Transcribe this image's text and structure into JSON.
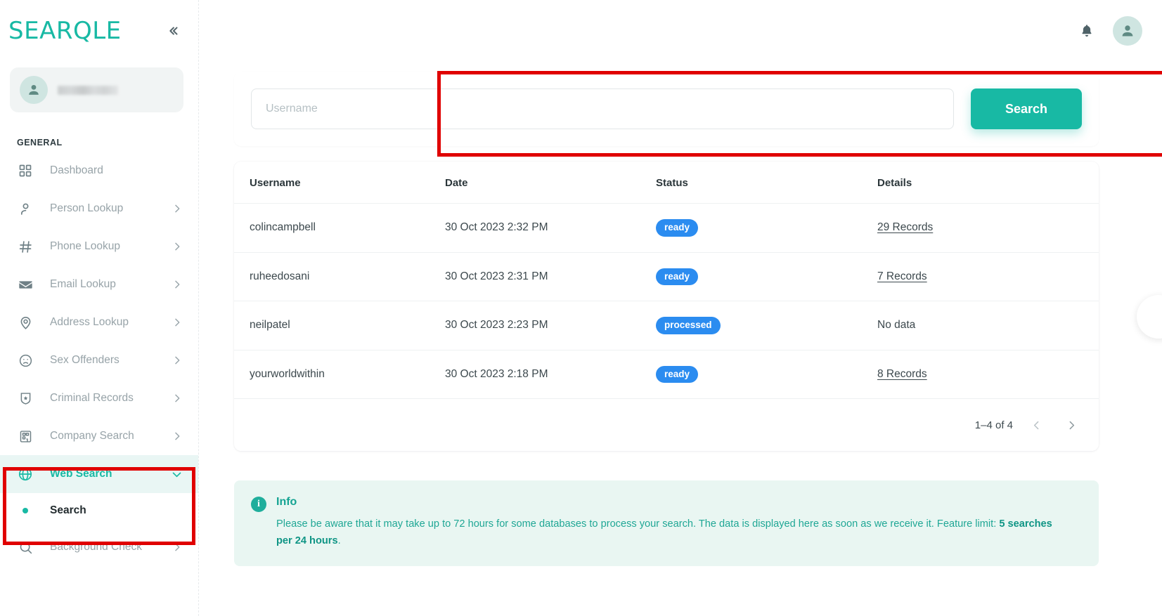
{
  "brand": {
    "name": "SEARQLE",
    "accent": "#18b9a4"
  },
  "sidebar": {
    "collapse_icon": "chevrons-left-icon",
    "profile": {
      "avatar_icon": "user-avatar-icon",
      "name_redacted": ""
    },
    "section_title": "GENERAL",
    "items": [
      {
        "label": "Dashboard",
        "icon": "grid-dashboard-icon",
        "caret": false
      },
      {
        "label": "Person Lookup",
        "icon": "person-icon",
        "caret": true
      },
      {
        "label": "Phone Lookup",
        "icon": "hash-icon",
        "caret": true
      },
      {
        "label": "Email Lookup",
        "icon": "envelope-icon",
        "caret": true
      },
      {
        "label": "Address Lookup",
        "icon": "map-pin-icon",
        "caret": true
      },
      {
        "label": "Sex Offenders",
        "icon": "sad-face-icon",
        "caret": true
      },
      {
        "label": "Criminal Records",
        "icon": "shield-badge-icon",
        "caret": true
      },
      {
        "label": "Company Search",
        "icon": "building-icon",
        "caret": true
      }
    ],
    "active_item": {
      "label": "Web Search",
      "icon": "globe-icon",
      "caret": "chevron-down-icon"
    },
    "active_subitem": {
      "label": "Search",
      "icon": "dot-bullet-icon"
    },
    "after_items": [
      {
        "label": "Background Check",
        "icon": "magnifier-icon",
        "caret": true
      }
    ]
  },
  "topbar": {
    "notifications_icon": "bell-icon",
    "account_icon": "user-avatar-icon"
  },
  "search": {
    "placeholder": "Username",
    "value": "",
    "button_label": "Search"
  },
  "table": {
    "columns": [
      "Username",
      "Date",
      "Status",
      "Details"
    ],
    "rows": [
      {
        "username": "colincampbell",
        "date": "30 Oct 2023 2:32 PM",
        "status": "ready",
        "details": "29 Records",
        "details_link": true
      },
      {
        "username": "ruheedosani",
        "date": "30 Oct 2023 2:31 PM",
        "status": "ready",
        "details": "7 Records",
        "details_link": true
      },
      {
        "username": "neilpatel",
        "date": "30 Oct 2023 2:23 PM",
        "status": "processed",
        "details": "No data",
        "details_link": false
      },
      {
        "username": "yourworldwithin",
        "date": "30 Oct 2023 2:18 PM",
        "status": "ready",
        "details": "8 Records",
        "details_link": true
      }
    ],
    "pagination": {
      "range_label": "1–4 of 4",
      "prev_icon": "chevron-left-icon",
      "next_icon": "chevron-right-icon"
    },
    "status_color": "#2b8cf0"
  },
  "info": {
    "icon": "info-circle-icon",
    "title": "Info",
    "text_part1": "Please be aware that it may take up to 72 hours for some databases to process your search. The data is displayed here as soon as we receive it. Feature limit: ",
    "text_bold": "5 searches per 24 hours",
    "text_part2": "."
  },
  "annotations": {
    "highlight_color": "#e00000",
    "boxes": [
      "search-bar-highlight",
      "web-search-nav-highlight"
    ]
  }
}
